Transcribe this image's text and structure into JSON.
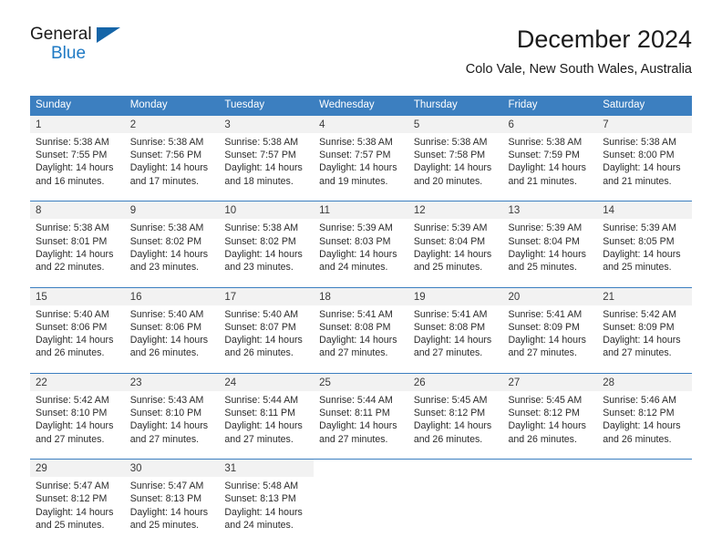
{
  "brand": {
    "name_top": "General",
    "name_bottom": "Blue",
    "accent_color": "#1f7ac4",
    "triangle_color": "#1565a8"
  },
  "header": {
    "title": "December 2024",
    "subtitle": "Colo Vale, New South Wales, Australia"
  },
  "theme": {
    "header_bg": "#3c7fc0",
    "daynum_bg": "#f2f2f2",
    "text_color": "#2b2b2b"
  },
  "calendar": {
    "weekday_headers": [
      "Sunday",
      "Monday",
      "Tuesday",
      "Wednesday",
      "Thursday",
      "Friday",
      "Saturday"
    ],
    "weeks": [
      [
        {
          "day": "1",
          "sunrise": "Sunrise: 5:38 AM",
          "sunset": "Sunset: 7:55 PM",
          "daylight_1": "Daylight: 14 hours",
          "daylight_2": "and 16 minutes."
        },
        {
          "day": "2",
          "sunrise": "Sunrise: 5:38 AM",
          "sunset": "Sunset: 7:56 PM",
          "daylight_1": "Daylight: 14 hours",
          "daylight_2": "and 17 minutes."
        },
        {
          "day": "3",
          "sunrise": "Sunrise: 5:38 AM",
          "sunset": "Sunset: 7:57 PM",
          "daylight_1": "Daylight: 14 hours",
          "daylight_2": "and 18 minutes."
        },
        {
          "day": "4",
          "sunrise": "Sunrise: 5:38 AM",
          "sunset": "Sunset: 7:57 PM",
          "daylight_1": "Daylight: 14 hours",
          "daylight_2": "and 19 minutes."
        },
        {
          "day": "5",
          "sunrise": "Sunrise: 5:38 AM",
          "sunset": "Sunset: 7:58 PM",
          "daylight_1": "Daylight: 14 hours",
          "daylight_2": "and 20 minutes."
        },
        {
          "day": "6",
          "sunrise": "Sunrise: 5:38 AM",
          "sunset": "Sunset: 7:59 PM",
          "daylight_1": "Daylight: 14 hours",
          "daylight_2": "and 21 minutes."
        },
        {
          "day": "7",
          "sunrise": "Sunrise: 5:38 AM",
          "sunset": "Sunset: 8:00 PM",
          "daylight_1": "Daylight: 14 hours",
          "daylight_2": "and 21 minutes."
        }
      ],
      [
        {
          "day": "8",
          "sunrise": "Sunrise: 5:38 AM",
          "sunset": "Sunset: 8:01 PM",
          "daylight_1": "Daylight: 14 hours",
          "daylight_2": "and 22 minutes."
        },
        {
          "day": "9",
          "sunrise": "Sunrise: 5:38 AM",
          "sunset": "Sunset: 8:02 PM",
          "daylight_1": "Daylight: 14 hours",
          "daylight_2": "and 23 minutes."
        },
        {
          "day": "10",
          "sunrise": "Sunrise: 5:38 AM",
          "sunset": "Sunset: 8:02 PM",
          "daylight_1": "Daylight: 14 hours",
          "daylight_2": "and 23 minutes."
        },
        {
          "day": "11",
          "sunrise": "Sunrise: 5:39 AM",
          "sunset": "Sunset: 8:03 PM",
          "daylight_1": "Daylight: 14 hours",
          "daylight_2": "and 24 minutes."
        },
        {
          "day": "12",
          "sunrise": "Sunrise: 5:39 AM",
          "sunset": "Sunset: 8:04 PM",
          "daylight_1": "Daylight: 14 hours",
          "daylight_2": "and 25 minutes."
        },
        {
          "day": "13",
          "sunrise": "Sunrise: 5:39 AM",
          "sunset": "Sunset: 8:04 PM",
          "daylight_1": "Daylight: 14 hours",
          "daylight_2": "and 25 minutes."
        },
        {
          "day": "14",
          "sunrise": "Sunrise: 5:39 AM",
          "sunset": "Sunset: 8:05 PM",
          "daylight_1": "Daylight: 14 hours",
          "daylight_2": "and 25 minutes."
        }
      ],
      [
        {
          "day": "15",
          "sunrise": "Sunrise: 5:40 AM",
          "sunset": "Sunset: 8:06 PM",
          "daylight_1": "Daylight: 14 hours",
          "daylight_2": "and 26 minutes."
        },
        {
          "day": "16",
          "sunrise": "Sunrise: 5:40 AM",
          "sunset": "Sunset: 8:06 PM",
          "daylight_1": "Daylight: 14 hours",
          "daylight_2": "and 26 minutes."
        },
        {
          "day": "17",
          "sunrise": "Sunrise: 5:40 AM",
          "sunset": "Sunset: 8:07 PM",
          "daylight_1": "Daylight: 14 hours",
          "daylight_2": "and 26 minutes."
        },
        {
          "day": "18",
          "sunrise": "Sunrise: 5:41 AM",
          "sunset": "Sunset: 8:08 PM",
          "daylight_1": "Daylight: 14 hours",
          "daylight_2": "and 27 minutes."
        },
        {
          "day": "19",
          "sunrise": "Sunrise: 5:41 AM",
          "sunset": "Sunset: 8:08 PM",
          "daylight_1": "Daylight: 14 hours",
          "daylight_2": "and 27 minutes."
        },
        {
          "day": "20",
          "sunrise": "Sunrise: 5:41 AM",
          "sunset": "Sunset: 8:09 PM",
          "daylight_1": "Daylight: 14 hours",
          "daylight_2": "and 27 minutes."
        },
        {
          "day": "21",
          "sunrise": "Sunrise: 5:42 AM",
          "sunset": "Sunset: 8:09 PM",
          "daylight_1": "Daylight: 14 hours",
          "daylight_2": "and 27 minutes."
        }
      ],
      [
        {
          "day": "22",
          "sunrise": "Sunrise: 5:42 AM",
          "sunset": "Sunset: 8:10 PM",
          "daylight_1": "Daylight: 14 hours",
          "daylight_2": "and 27 minutes."
        },
        {
          "day": "23",
          "sunrise": "Sunrise: 5:43 AM",
          "sunset": "Sunset: 8:10 PM",
          "daylight_1": "Daylight: 14 hours",
          "daylight_2": "and 27 minutes."
        },
        {
          "day": "24",
          "sunrise": "Sunrise: 5:44 AM",
          "sunset": "Sunset: 8:11 PM",
          "daylight_1": "Daylight: 14 hours",
          "daylight_2": "and 27 minutes."
        },
        {
          "day": "25",
          "sunrise": "Sunrise: 5:44 AM",
          "sunset": "Sunset: 8:11 PM",
          "daylight_1": "Daylight: 14 hours",
          "daylight_2": "and 27 minutes."
        },
        {
          "day": "26",
          "sunrise": "Sunrise: 5:45 AM",
          "sunset": "Sunset: 8:12 PM",
          "daylight_1": "Daylight: 14 hours",
          "daylight_2": "and 26 minutes."
        },
        {
          "day": "27",
          "sunrise": "Sunrise: 5:45 AM",
          "sunset": "Sunset: 8:12 PM",
          "daylight_1": "Daylight: 14 hours",
          "daylight_2": "and 26 minutes."
        },
        {
          "day": "28",
          "sunrise": "Sunrise: 5:46 AM",
          "sunset": "Sunset: 8:12 PM",
          "daylight_1": "Daylight: 14 hours",
          "daylight_2": "and 26 minutes."
        }
      ],
      [
        {
          "day": "29",
          "sunrise": "Sunrise: 5:47 AM",
          "sunset": "Sunset: 8:12 PM",
          "daylight_1": "Daylight: 14 hours",
          "daylight_2": "and 25 minutes."
        },
        {
          "day": "30",
          "sunrise": "Sunrise: 5:47 AM",
          "sunset": "Sunset: 8:13 PM",
          "daylight_1": "Daylight: 14 hours",
          "daylight_2": "and 25 minutes."
        },
        {
          "day": "31",
          "sunrise": "Sunrise: 5:48 AM",
          "sunset": "Sunset: 8:13 PM",
          "daylight_1": "Daylight: 14 hours",
          "daylight_2": "and 24 minutes."
        },
        null,
        null,
        null,
        null
      ]
    ]
  }
}
